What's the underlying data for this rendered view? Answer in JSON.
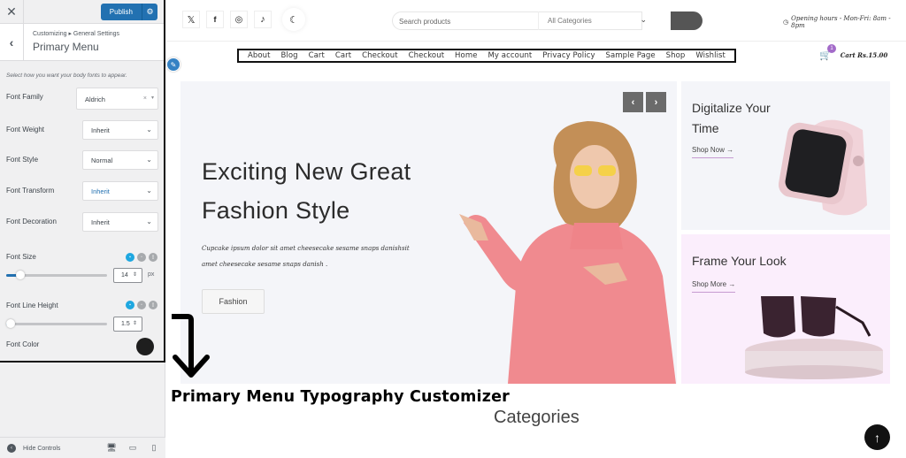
{
  "customizer": {
    "publish_label": "Publish",
    "breadcrumb": "Customizing ▸ General Settings",
    "panel_title": "Primary Menu",
    "description": "Select how you want your body fonts to appear.",
    "fields": {
      "font_family": {
        "label": "Font Family",
        "value": "Aldrich"
      },
      "font_weight": {
        "label": "Font Weight",
        "value": "Inherit"
      },
      "font_style": {
        "label": "Font Style",
        "value": "Normal"
      },
      "font_transform": {
        "label": "Font Transform",
        "value": "Inherit"
      },
      "font_decoration": {
        "label": "Font Decoration",
        "value": "Inherit"
      },
      "font_size": {
        "label": "Font Size",
        "value": "14",
        "unit": "px",
        "slider_fraction": 0.14
      },
      "font_line_height": {
        "label": "Font Line Height",
        "value": "1.5",
        "slider_fraction": 0.02
      },
      "font_color": {
        "label": "Font Color",
        "value": "#1e1e1e"
      }
    },
    "hide_controls_label": "Hide Controls",
    "accent_color": "#2271b1"
  },
  "site": {
    "search_placeholder": "Search products",
    "category_select": "All Categories",
    "opening_hours": "Opening hours - Mon-Fri: 8am - 8pm",
    "menu": [
      "About",
      "Blog",
      "Cart",
      "Cart",
      "Checkout",
      "Checkout",
      "Home",
      "My account",
      "Privacy Policy",
      "Sample Page",
      "Shop",
      "Wishlist"
    ],
    "cart": {
      "count": "1",
      "label": "Cart Rs.15.00"
    },
    "hero": {
      "title": "Exciting New Great Fashion Style",
      "text": "Cupcake ipsum dolor sit amet cheesecake sesame snaps danishsit amet cheesecake sesame snaps danish .",
      "button": "Fashion"
    },
    "promos": [
      {
        "title": "Digitalize Your Time",
        "link": "Shop Now →"
      },
      {
        "title": "Frame Your Look",
        "link": "Shop More →"
      }
    ],
    "section_heading": "Categories"
  },
  "annotation": "Primary Menu Typography Customizer"
}
